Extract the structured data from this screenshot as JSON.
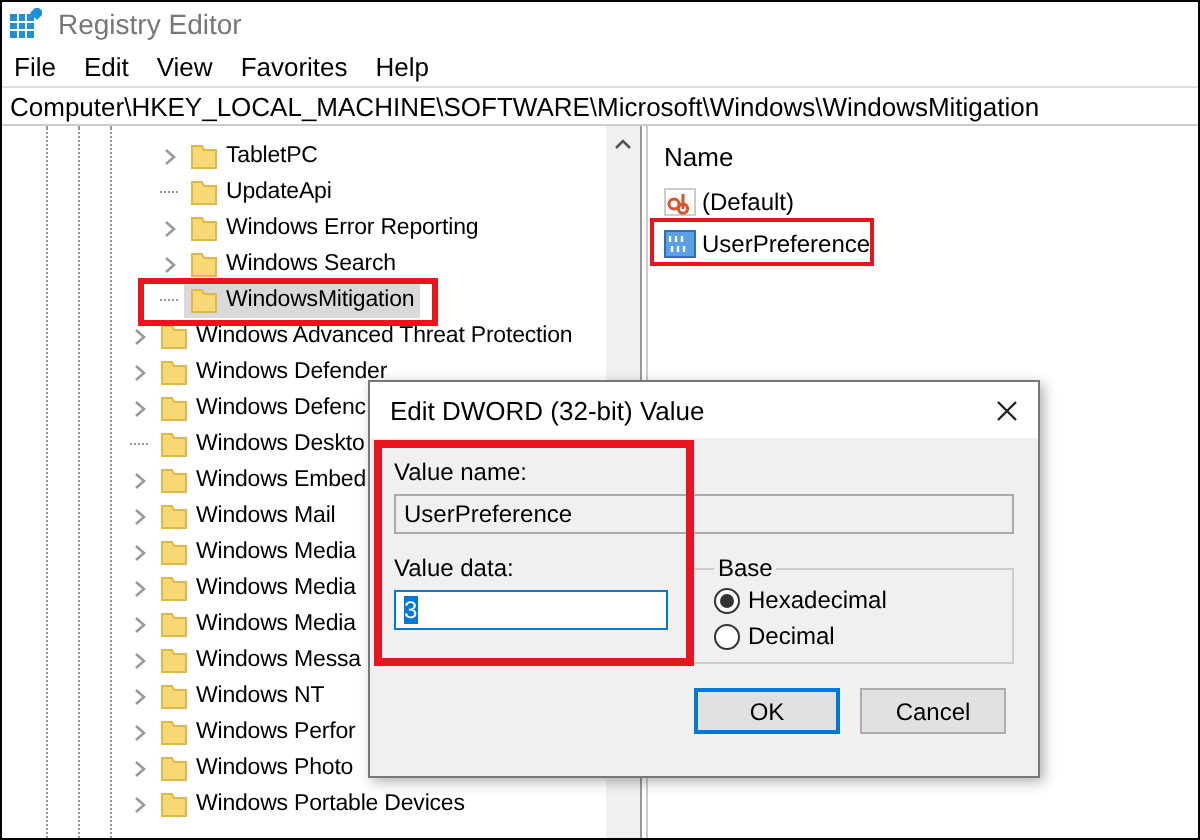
{
  "window": {
    "title": "Registry Editor"
  },
  "menu": [
    "File",
    "Edit",
    "View",
    "Favorites",
    "Help"
  ],
  "address": "Computer\\HKEY_LOCAL_MACHINE\\SOFTWARE\\Microsoft\\Windows\\WindowsMitigation",
  "tree": {
    "items": [
      {
        "children": [
          {
            "label": "TabletPC",
            "expandable": true,
            "selected": false
          },
          {
            "label": "UpdateApi",
            "expandable": false,
            "selected": false
          },
          {
            "label": "Windows Error Reporting",
            "expandable": true,
            "selected": false
          },
          {
            "label": "Windows Search",
            "expandable": true,
            "selected": false
          },
          {
            "label": "WindowsMitigation",
            "expandable": false,
            "selected": true
          }
        ]
      },
      {
        "label": "Windows Advanced Threat Protection",
        "expandable": true,
        "selected": false
      },
      {
        "label": "Windows Defender",
        "expandable": true,
        "selected": false
      },
      {
        "label": "Windows Defenc",
        "expandable": true,
        "selected": false
      },
      {
        "label": "Windows Deskto",
        "expandable": false,
        "selected": false
      },
      {
        "label": "Windows Embed",
        "expandable": true,
        "selected": false
      },
      {
        "label": "Windows Mail",
        "expandable": true,
        "selected": false
      },
      {
        "label": "Windows Media",
        "expandable": true,
        "selected": false
      },
      {
        "label": "Windows Media",
        "expandable": true,
        "selected": false
      },
      {
        "label": "Windows Media",
        "expandable": true,
        "selected": false
      },
      {
        "label": "Windows Messa",
        "expandable": true,
        "selected": false
      },
      {
        "label": "Windows NT",
        "expandable": true,
        "selected": false
      },
      {
        "label": "Windows Perfor",
        "expandable": true,
        "selected": false
      },
      {
        "label": "Windows Photo",
        "expandable": true,
        "selected": false
      },
      {
        "label": "Windows Portable Devices",
        "expandable": true,
        "selected": false
      }
    ]
  },
  "values": {
    "column": "Name",
    "rows": [
      {
        "name": "(Default)",
        "kind": "string",
        "selected": false
      },
      {
        "name": "UserPreference",
        "kind": "binary",
        "selected": false
      }
    ]
  },
  "dialog": {
    "title": "Edit DWORD (32-bit) Value",
    "value_name_label": "Value name:",
    "value_name": "UserPreference",
    "value_data_label": "Value data:",
    "value_data": "3",
    "base": {
      "label": "Base",
      "options": [
        {
          "label": "Hexadecimal",
          "selected": true
        },
        {
          "label": "Decimal",
          "selected": false
        }
      ]
    },
    "buttons": [
      {
        "label": "OK",
        "default": true
      },
      {
        "label": "Cancel",
        "default": false
      }
    ]
  }
}
